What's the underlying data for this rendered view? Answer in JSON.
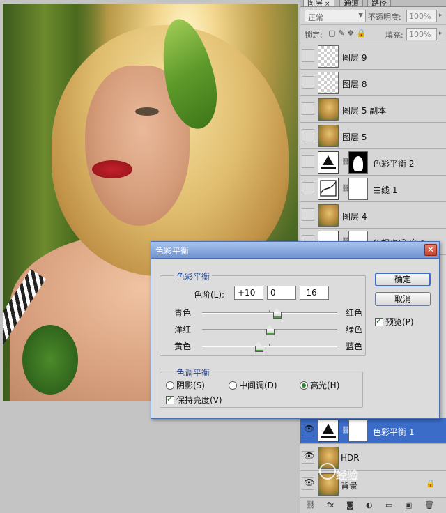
{
  "panel": {
    "tabs": [
      {
        "label": "图层",
        "close": "×"
      },
      {
        "label": "通道"
      },
      {
        "label": "路径"
      }
    ],
    "blend_mode": "正常",
    "opacity_label": "不透明度:",
    "opacity_value": "100%",
    "lock_label": "锁定:",
    "fill_label": "填充:",
    "fill_value": "100%",
    "layers": [
      {
        "name": "图层 9",
        "visible": false
      },
      {
        "name": "图层 8",
        "visible": false
      },
      {
        "name": "图层 5 副本",
        "visible": false
      },
      {
        "name": "图层 5",
        "visible": false
      },
      {
        "name": "色彩平衡 2",
        "visible": false
      },
      {
        "name": "曲线 1",
        "visible": false
      },
      {
        "name": "图层 4",
        "visible": false
      },
      {
        "name": "色相/饱和度 1",
        "visible": false
      },
      {
        "name": "色彩平衡 1",
        "visible": true,
        "selected": true
      },
      {
        "name": "HDR",
        "visible": true
      },
      {
        "name": "背景",
        "visible": true
      }
    ]
  },
  "dialog": {
    "title": "色彩平衡",
    "color_balance_group": "色彩平衡",
    "levels_label": "色阶(L):",
    "levels": [
      "+10",
      "0",
      "-16"
    ],
    "sliders": [
      {
        "left": "青色",
        "right": "红色",
        "value": 10
      },
      {
        "left": "洋红",
        "right": "绿色",
        "value": 0
      },
      {
        "left": "黄色",
        "right": "蓝色",
        "value": -16
      }
    ],
    "tone_group": "色调平衡",
    "tones": [
      {
        "label": "阴影(S)",
        "selected": false
      },
      {
        "label": "中间调(D)",
        "selected": false
      },
      {
        "label": "高光(H)",
        "selected": true
      }
    ],
    "preserve_luminosity": "保持亮度(V)",
    "preserve_checked": true,
    "ok": "确定",
    "cancel": "取消",
    "preview": "预览(P)",
    "preview_checked": true
  },
  "watermark": "经验"
}
